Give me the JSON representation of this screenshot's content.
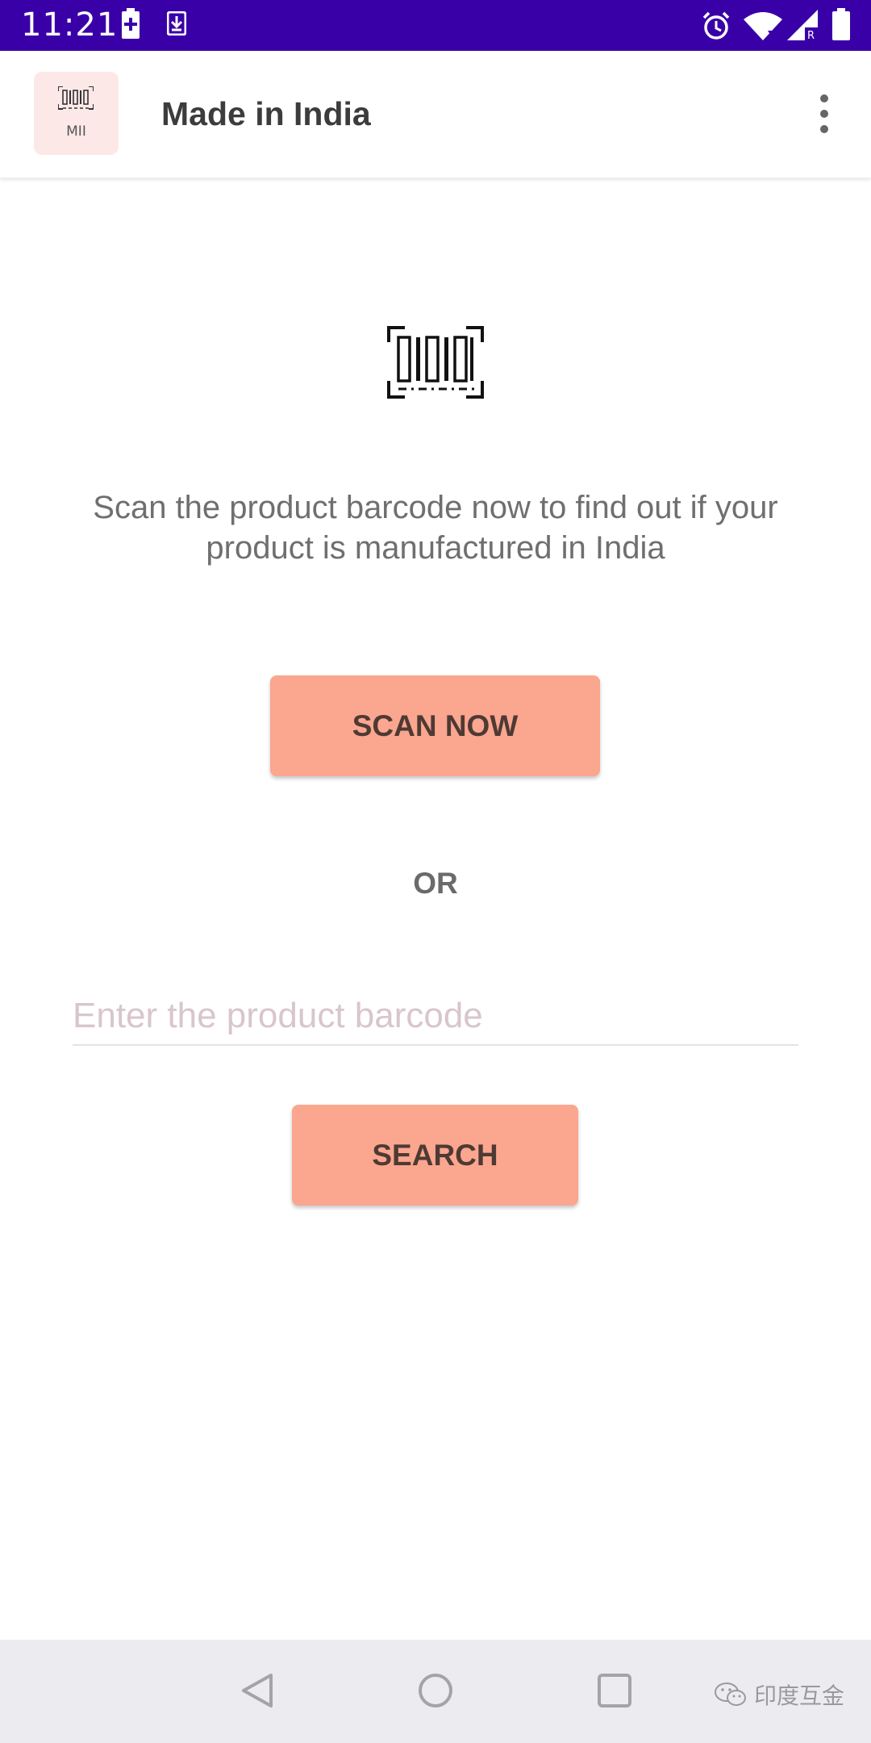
{
  "status_bar": {
    "time": "11:21",
    "left_icons": [
      "battery-plus-icon",
      "download-icon"
    ],
    "right_icons": [
      "alarm-icon",
      "wifi-icon",
      "signal-icon",
      "battery-icon"
    ],
    "background": "#3a00a8"
  },
  "app_bar": {
    "logo_text": "MII",
    "title": "Made in India",
    "menu_icon": "more-vert-icon"
  },
  "main": {
    "barcode_icon": "barcode-scan-icon",
    "instruction": "Scan the product barcode now to find out if your product is manufactured in India",
    "scan_button_label": "SCAN NOW",
    "or_label": "OR",
    "barcode_input": {
      "value": "",
      "placeholder": "Enter the product barcode"
    },
    "search_button_label": "SEARCH",
    "accent_color": "#fba68f"
  },
  "nav_bar": {
    "buttons": [
      "back-icon",
      "home-icon",
      "recents-icon"
    ]
  },
  "watermark": {
    "text": "印度互金"
  }
}
